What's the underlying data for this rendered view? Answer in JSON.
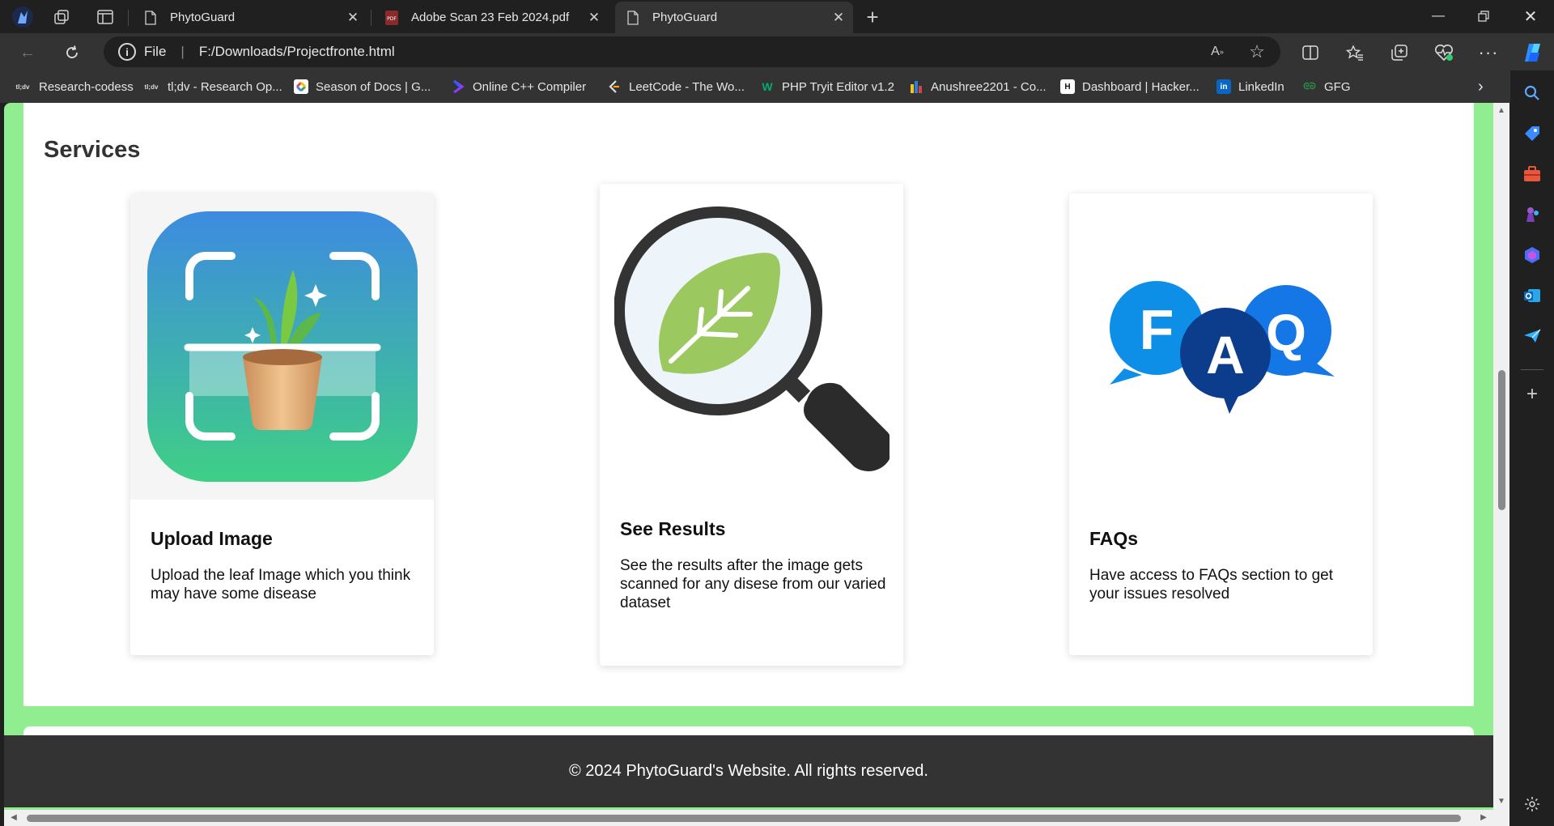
{
  "browser": {
    "tabs": [
      {
        "title": "PhytoGuard",
        "active": false
      },
      {
        "title": "Adobe Scan 23 Feb 2024.pdf",
        "active": false
      },
      {
        "title": "PhytoGuard",
        "active": true
      }
    ],
    "address": {
      "protocol": "File",
      "url": "F:/Downloads/Projectfronte.html"
    },
    "bookmarks": [
      {
        "label": "Research-codess",
        "icon": "tldv-icon"
      },
      {
        "label": "tl;dv - Research Op...",
        "icon": "tldv-icon"
      },
      {
        "label": "Season of Docs  |  G...",
        "icon": "google-icon"
      },
      {
        "label": "Online C++ Compiler",
        "icon": "compiler-icon"
      },
      {
        "label": "LeetCode - The Wo...",
        "icon": "leetcode-icon"
      },
      {
        "label": "PHP Tryit Editor v1.2",
        "icon": "w3schools-icon"
      },
      {
        "label": "Anushree2201 - Co...",
        "icon": "chart-icon"
      },
      {
        "label": "Dashboard | Hacker...",
        "icon": "hackerrank-icon"
      },
      {
        "label": "LinkedIn",
        "icon": "linkedin-icon"
      },
      {
        "label": "GFG",
        "icon": "gfg-icon"
      }
    ],
    "tldv_text": "tl;dv"
  },
  "page": {
    "services": {
      "heading": "Services",
      "cards": [
        {
          "title": "Upload Image",
          "description": "Upload the leaf Image which you think may have some disease",
          "image": "plant-scan-icon"
        },
        {
          "title": "See Results",
          "description": "See the results after the image gets scanned for any disese from our varied dataset",
          "image": "leaf-magnifier-icon"
        },
        {
          "title": "FAQs",
          "description": "Have access to FAQs section to get your issues resolved",
          "image": "faq-bubbles-icon"
        }
      ],
      "faq_letters": [
        "F",
        "A",
        "Q"
      ]
    },
    "footer": {
      "text": "© 2024 PhytoGuard's Website. All rights reserved."
    }
  },
  "colors": {
    "page_background": "#90ee90",
    "card_background": "#ffffff",
    "footer_background": "#333333",
    "browser_chrome": "#202020",
    "browser_toolbar": "#333333"
  }
}
